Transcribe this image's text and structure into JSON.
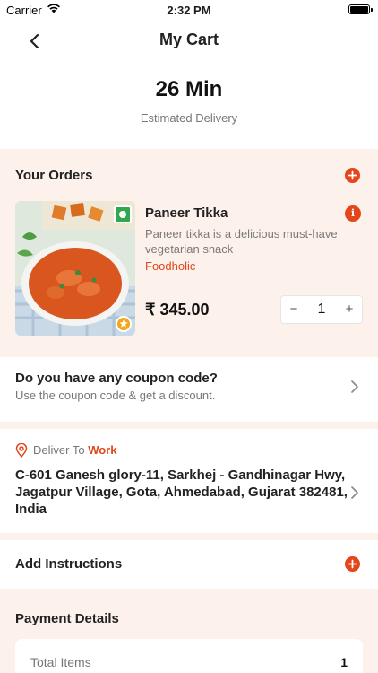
{
  "status_bar": {
    "carrier": "Carrier",
    "time": "2:32 PM"
  },
  "nav": {
    "title": "My Cart"
  },
  "eta": {
    "value": "26 Min",
    "label": "Estimated Delivery"
  },
  "orders": {
    "title": "Your Orders",
    "item": {
      "name": "Paneer Tikka",
      "description": "Paneer tikka is a delicious must-have vegetarian snack",
      "restaurant": "Foodholic",
      "price": "₹ 345.00",
      "quantity": "1",
      "minus_label": "−",
      "plus_label": "+"
    }
  },
  "coupon": {
    "title": "Do you have any coupon code?",
    "subtitle": "Use the coupon code & get a discount."
  },
  "delivery": {
    "label": "Deliver To",
    "place": "Work",
    "address": "C-601 Ganesh glory-11, Sarkhej - Gandhinagar Hwy, Jagatpur Village, Gota, Ahmedabad, Gujarat 382481, India"
  },
  "instructions": {
    "title": "Add Instructions"
  },
  "payment": {
    "title": "Payment Details",
    "total_items_label": "Total Items",
    "total_items_value": "1"
  },
  "colors": {
    "accent": "#e2461a",
    "panel": "#fdf1ec",
    "veg": "#2fa84f",
    "star": "#f2a516"
  },
  "icons": [
    "back-icon",
    "plus-icon",
    "info-icon",
    "chevron-right-icon",
    "location-pin-icon",
    "veg-icon",
    "star-icon",
    "wifi-icon",
    "battery-icon"
  ]
}
